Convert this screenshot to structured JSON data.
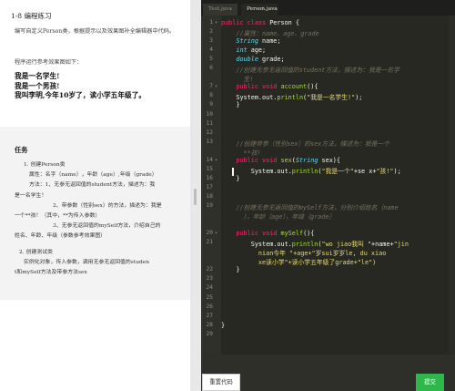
{
  "exercise": {
    "title": "1-8 编程练习",
    "description": "编写自定义Person类，根据提示以及效果图补全编辑器中代码。",
    "reference_label": "程序运行参考效果图如下：",
    "output_lines": [
      "我是一名学生!",
      "我是一个男孩!",
      "我叫李明,今年10岁了，读小学五年级了。"
    ]
  },
  "task": {
    "heading": "任务",
    "lines": [
      "1. 创建Person类",
      "属性：名字（name），年龄（age）,年级（grade）",
      "方法：1、无参无返回值的student方法，描述为：我",
      "是一名学生！",
      "2、带参数（性别sex）的方法，描述为：我是",
      "一个**孩！（其中，**为传入参数）",
      "3、无参无返回值的mySelf方法，介绍自己的",
      "姓名、年龄、年级（参数参考效果图）",
      "2. 创建测试类",
      "实例化对象，传入参数，调用无参无返回值的studen",
      "t和mySelf方法及带参方法sex"
    ]
  },
  "editor": {
    "tabs": [
      {
        "label": "Test.java",
        "active": false
      },
      {
        "label": "Person.java",
        "active": true
      }
    ],
    "line_numbers": [
      "1",
      "2",
      "3",
      "4",
      "5",
      "6",
      "",
      "7",
      "8",
      "9",
      "10",
      "11",
      "12",
      "13",
      "",
      "14",
      "15",
      "16",
      "17",
      "18",
      "19",
      "",
      "",
      "20",
      "21",
      "",
      "",
      "22",
      "23",
      "24",
      "25",
      "26",
      "27",
      "28",
      "29",
      "30"
    ],
    "lines": [
      "public class Person {",
      "    //属性：name、age、grade",
      "    String name;",
      "    int age;",
      "    double grade;",
      "    //创建无参无返回值的student方法，描述为：我是一名学",
      "      生!",
      "    public void account(){",
      "    System.out.println(\"我是一名学生!\");",
      "    }",
      "",
      "",
      "",
      "    //创建带参（性别sex）的sex方法，描述为：我是一个",
      "      **孩!",
      "    public void sex(String sex){",
      "        System.out.println(\"我是一个\"+se x+\"孩!\");",
      "    }",
      "",
      "",
      "    //创建无参无返回值的mySelf方法，分别介绍姓名（name",
      "      ），年龄（age），年级（grade）",
      "",
      "    public void mySelf(){",
      "        System.out.println(\"wo jiao我叫 \"+name+\"jin",
      "          nian今年 \"+age+\"岁sui岁岁le, du xiao",
      "          xe读小学\"+读小学五年级了grade+\"le\")",
      "    }",
      "",
      "",
      "",
      "",
      "",
      "}",
      ""
    ]
  },
  "buttons": {
    "reset": "重置代码",
    "submit": "提交"
  },
  "colors": {
    "editor_bg": "#272822",
    "keyword": "#f92672",
    "type": "#66d9ef",
    "string": "#e6db74",
    "comment": "#75715e",
    "submit_green": "#2eb84b"
  }
}
